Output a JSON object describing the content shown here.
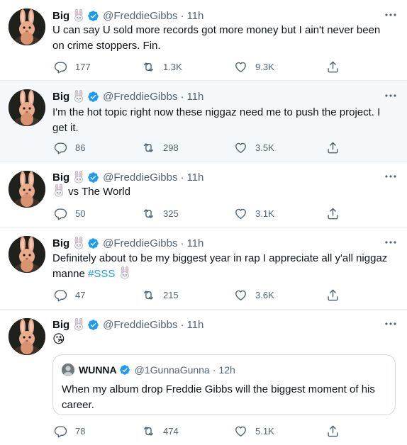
{
  "author": {
    "name": "Big",
    "handle": "@FreddieGibbs",
    "time": "11h"
  },
  "tweets": [
    {
      "text": "U can say U sold more records got more money but I ain't never been on crime stoppers. Fin.",
      "replies": "177",
      "retweets": "1.3K",
      "likes": "9.3K"
    },
    {
      "text": "I'm the hot topic right now these niggaz need me to push the project.  I get it.",
      "replies": "86",
      "retweets": "298",
      "likes": "3.5K"
    },
    {
      "text_after_icon": "vs The World",
      "replies": "50",
      "retweets": "325",
      "likes": "3.1K"
    },
    {
      "text": "Definitely about to be my biggest year in rap I appreciate all y'all niggaz manne ",
      "hashtag": "#SSS",
      "replies": "47",
      "retweets": "215",
      "likes": "3.6K"
    },
    {
      "emoji": "😘",
      "quote": {
        "name": "WUNNA",
        "handle": "@1GunnaGunna",
        "time": "12h",
        "text": "When my album drop Freddie Gibbs will the biggest moment of his career."
      },
      "replies": "78",
      "retweets": "474",
      "likes": "5.1K"
    }
  ],
  "colors": {
    "accent": "#1d9bf0",
    "muted": "#536471",
    "highlight_bg": "#f5f8fa",
    "divider": "#e6ecf0"
  },
  "icons": [
    "rabbit-icon",
    "verified-badge-icon",
    "more-options-icon",
    "reply-icon",
    "retweet-icon",
    "like-icon",
    "share-icon"
  ]
}
